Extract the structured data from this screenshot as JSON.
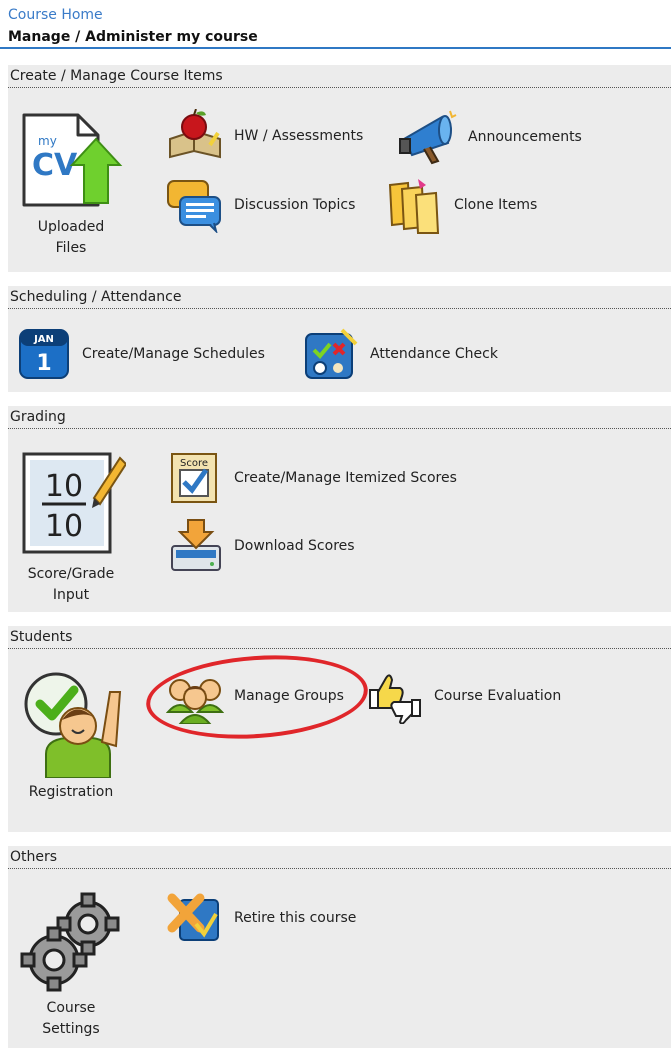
{
  "breadcrumb": "Course Home",
  "page_title": "Manage / Administer my course",
  "sections": {
    "create": {
      "title": "Create / Manage Course Items",
      "uploaded_files": "Uploaded Files",
      "hw_assessments": "HW / Assessments",
      "announcements": "Announcements",
      "discussion_topics": "Discussion Topics",
      "clone_items": "Clone Items",
      "mycv_icon_text": "my",
      "mycv_icon_big": "CV"
    },
    "scheduling": {
      "title": "Scheduling / Attendance",
      "create_schedules": "Create/Manage Schedules",
      "attendance_check": "Attendance Check",
      "calendar_month": "JAN",
      "calendar_day": "1"
    },
    "grading": {
      "title": "Grading",
      "score_grade_input": "Score/Grade Input",
      "itemized_scores": "Create/Manage Itemized Scores",
      "download_scores": "Download Scores",
      "score_icon_text": "Score",
      "fraction_top": "10",
      "fraction_bottom": "10"
    },
    "students": {
      "title": "Students",
      "registration": "Registration",
      "manage_groups": "Manage Groups",
      "course_evaluation": "Course Evaluation"
    },
    "others": {
      "title": "Others",
      "course_settings": "Course Settings",
      "retire_course": "Retire this course"
    }
  },
  "colors": {
    "link": "#3a7bc8",
    "rule": "#2f78c4",
    "panel": "#ececec",
    "highlight_circle": "#e0262a"
  }
}
